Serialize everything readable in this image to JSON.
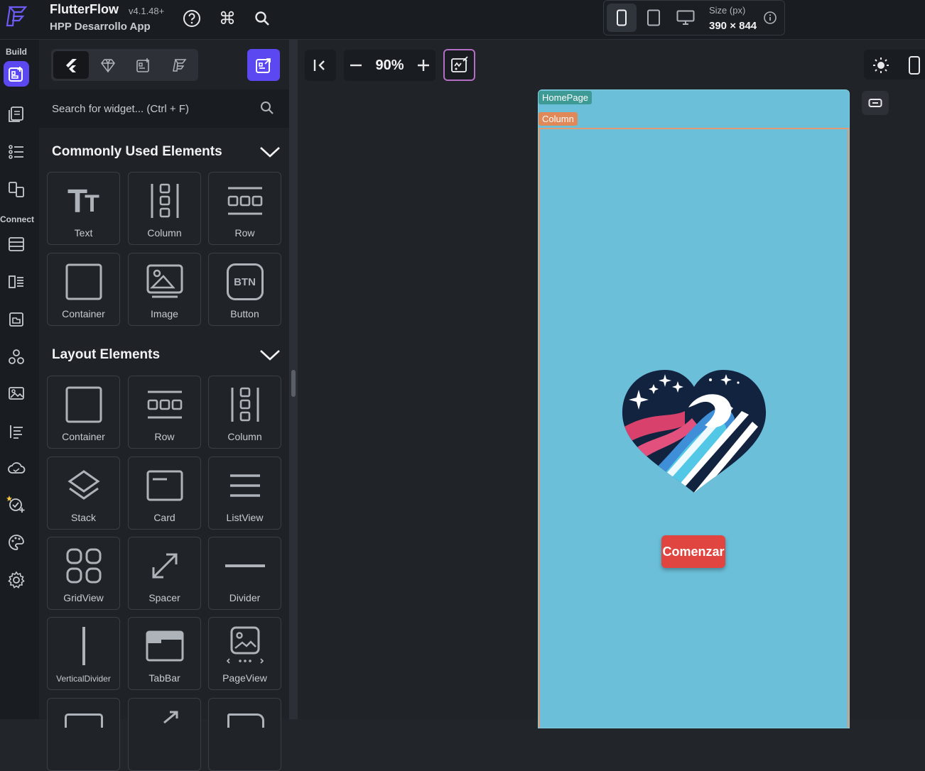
{
  "app": {
    "name": "FlutterFlow",
    "version": "v4.1.48+",
    "project": "HPP Desarrollo App"
  },
  "device": {
    "size_label": "Size (px)",
    "size_value": "390 × 844"
  },
  "rail": {
    "build_label": "Build",
    "connect_label": "Connect"
  },
  "panel": {
    "search_placeholder": "Search for widget... (Ctrl + F)",
    "sections": [
      {
        "title": "Commonly Used Elements",
        "items": [
          "Text",
          "Column",
          "Row",
          "Container",
          "Image",
          "Button"
        ]
      },
      {
        "title": "Layout Elements",
        "items": [
          "Container",
          "Row",
          "Column",
          "Stack",
          "Card",
          "ListView",
          "GridView",
          "Spacer",
          "Divider",
          "VerticalDivider",
          "TabBar",
          "PageView"
        ]
      }
    ],
    "button_glyph": "BTN"
  },
  "canvas": {
    "zoom": "90%",
    "page_tag": "HomePage",
    "column_tag": "Column",
    "cta_label": "Comenzar"
  },
  "colors": {
    "accent": "#5b48f0",
    "canvas_bg": "#6bbfd8",
    "cta": "#e0453f"
  }
}
